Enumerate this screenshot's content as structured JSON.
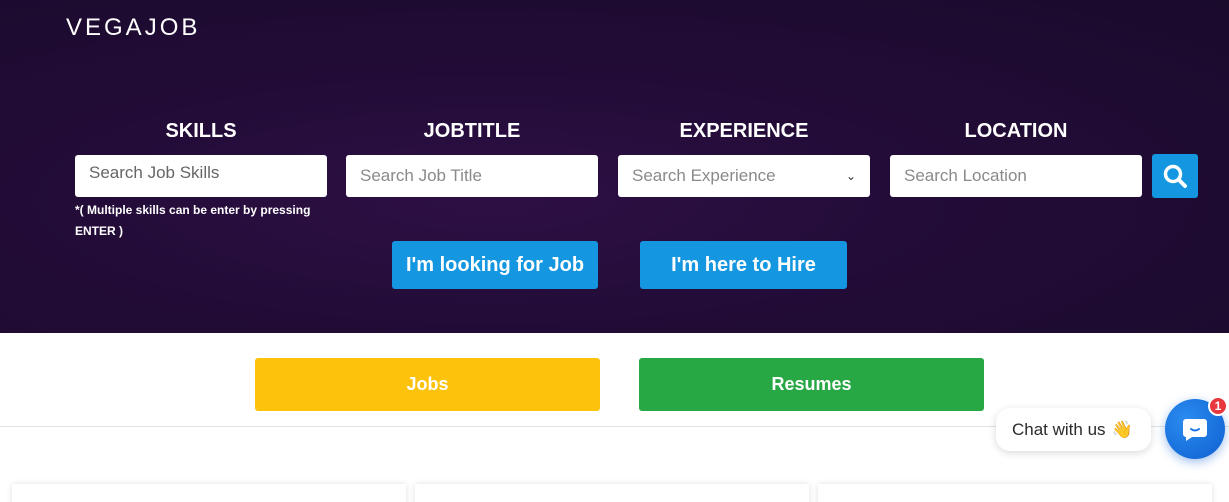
{
  "brand": "VEGAJOB",
  "search": {
    "skills": {
      "label": "SKILLS",
      "placeholder": "Search Job Skills",
      "hint": "*( Multiple skills can be enter by pressing ENTER )"
    },
    "jobtitle": {
      "label": "JOBTITLE",
      "placeholder": "Search Job Title"
    },
    "experience": {
      "label": "EXPERIENCE",
      "placeholder": "Search Experience"
    },
    "location": {
      "label": "LOCATION",
      "placeholder": "Search Location"
    },
    "button_icon": "search-icon"
  },
  "cta": {
    "seeker": "I'm looking for Job",
    "hirer": "I'm here to Hire"
  },
  "tabs": {
    "jobs": "Jobs",
    "resumes": "Resumes"
  },
  "chat": {
    "label": "Chat with us",
    "emoji": "👋",
    "badge": "1"
  },
  "colors": {
    "hero_bg": "#220c37",
    "accent_blue": "#1596e0",
    "jobs_yellow": "#fdc20b",
    "resumes_green": "#28a745",
    "chat_blue": "#1b73e8",
    "badge_red": "#e8383d"
  }
}
